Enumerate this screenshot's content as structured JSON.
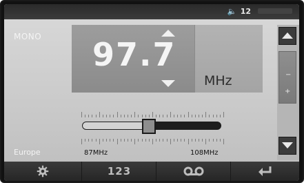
{
  "status": {
    "volume_level": "12"
  },
  "audio_mode": "MONO",
  "region": "Europe",
  "frequency": {
    "value": "97.7",
    "unit": "MHz"
  },
  "tuner": {
    "band_min_label": "87MHz",
    "band_max_label": "108MHz",
    "position_fraction": 0.48
  },
  "bottom_bar": {
    "settings_icon": "gear-icon",
    "keypad_label": "123",
    "tape_icon": "tape-icon",
    "back_icon": "return-arrow-icon"
  },
  "icons": {
    "speaker": "speaker-icon",
    "freq_up": "chevron-up-icon",
    "freq_down": "chevron-down-icon",
    "scroll_up": "triangle-up-icon",
    "scroll_down": "triangle-down-icon"
  }
}
